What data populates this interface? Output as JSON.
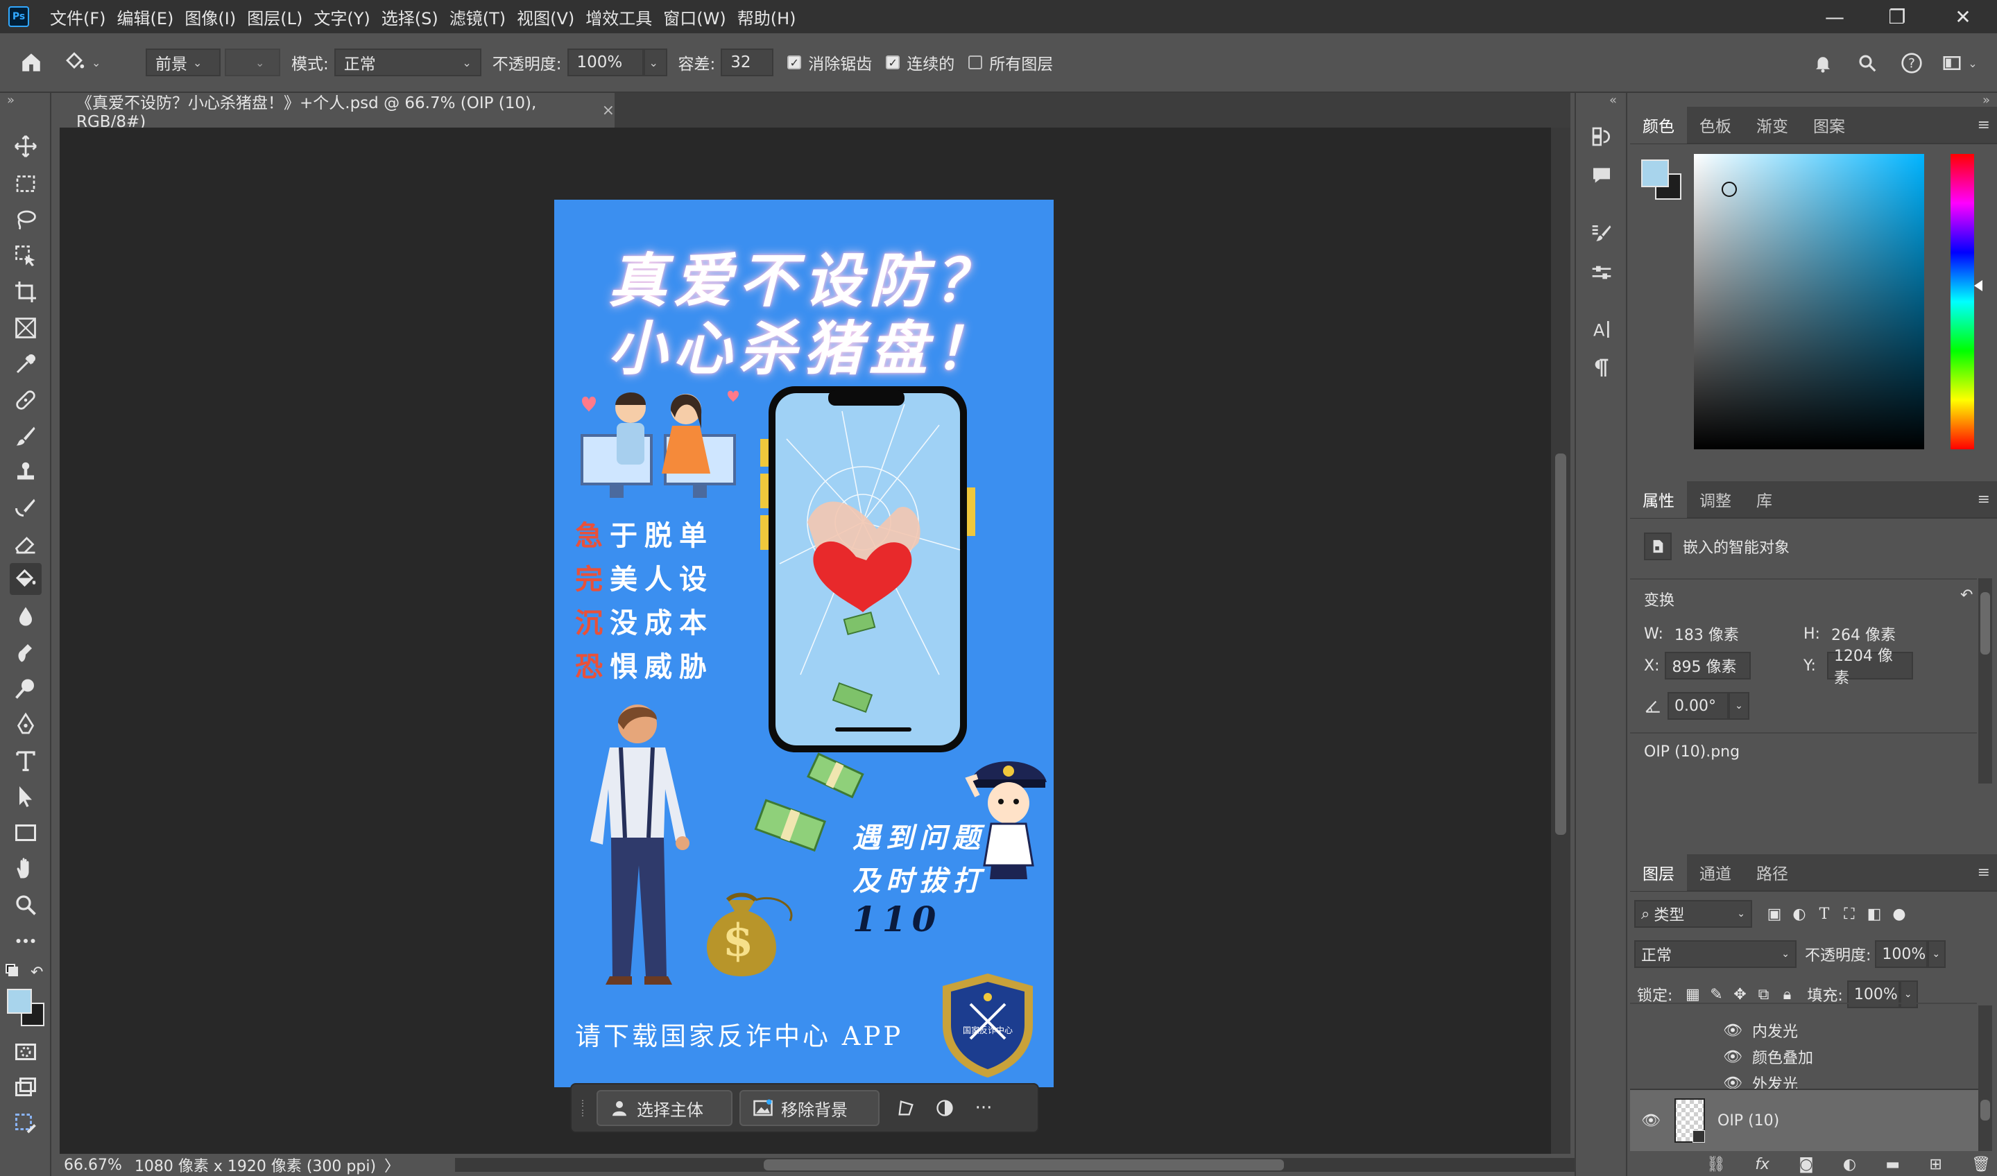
{
  "app": {
    "logo": "Ps"
  },
  "menu": [
    "文件(F)",
    "编辑(E)",
    "图像(I)",
    "图层(L)",
    "文字(Y)",
    "选择(S)",
    "滤镜(T)",
    "视图(V)",
    "增效工具",
    "窗口(W)",
    "帮助(H)"
  ],
  "window_controls": {
    "minimize": "—",
    "restore": "❐",
    "close": "✕"
  },
  "options": {
    "fill_source": "前景",
    "mode_label": "模式:",
    "mode_value": "正常",
    "opacity_label": "不透明度:",
    "opacity_value": "100%",
    "tolerance_label": "容差:",
    "tolerance_value": "32",
    "antialias_label": "消除锯齿",
    "contiguous_label": "连续的",
    "all_layers_label": "所有图层",
    "antialias_checked": true,
    "contiguous_checked": true,
    "all_layers_checked": false
  },
  "document": {
    "tab_title": "《真爱不设防？小心杀猪盘！》+个人.psd @ 66.7% (OIP (10), RGB/8#)",
    "tab_close": "×"
  },
  "poster": {
    "title_line1": "真爱不设防？",
    "title_line2": "小心杀猪盘！",
    "bullets": [
      {
        "hl": "急",
        "rest": "于脱单"
      },
      {
        "hl": "完",
        "rest": "美人设"
      },
      {
        "hl": "沉",
        "rest": "没成本"
      },
      {
        "hl": "恐",
        "rest": "惧威胁"
      }
    ],
    "call_line1": "遇到问题",
    "call_line2": "及时拔打",
    "call_number": "110",
    "app_text": "请下载国家反诈中心 APP",
    "badge_text": "国家反诈中心",
    "colors": {
      "background": "#3b8ff0",
      "highlight": "#e8513a"
    }
  },
  "context_bar": {
    "select_subject": "选择主体",
    "remove_background": "移除背景",
    "more": "···"
  },
  "status": {
    "zoom": "66.67%",
    "dimensions": "1080 像素 x 1920 像素 (300 ppi)",
    "arrow": "〉"
  },
  "color_panel": {
    "tabs": [
      "颜色",
      "色板",
      "渐变",
      "图案"
    ],
    "foreground": "#a8d4ec",
    "background": "#1e1e1e"
  },
  "properties_panel": {
    "tabs": [
      "属性",
      "调整",
      "库"
    ],
    "object_type": "嵌入的智能对象",
    "section": "变换",
    "w_label": "W:",
    "w_value": "183 像素",
    "h_label": "H:",
    "h_value": "264 像素",
    "x_label": "X:",
    "x_value": "895 像素",
    "y_label": "Y:",
    "y_value": "1204 像素",
    "angle_value": "0.00°",
    "filename": "OIP (10).png"
  },
  "layers_panel": {
    "tabs": [
      "图层",
      "通道",
      "路径"
    ],
    "filter_label": "类型",
    "blend_mode": "正常",
    "opacity_label": "不透明度:",
    "opacity_value": "100%",
    "lock_label": "锁定:",
    "fill_label": "填充:",
    "fill_value": "100%",
    "effects": [
      "内发光",
      "颜色叠加",
      "外发光"
    ],
    "layer_name": "OIP (10)"
  }
}
